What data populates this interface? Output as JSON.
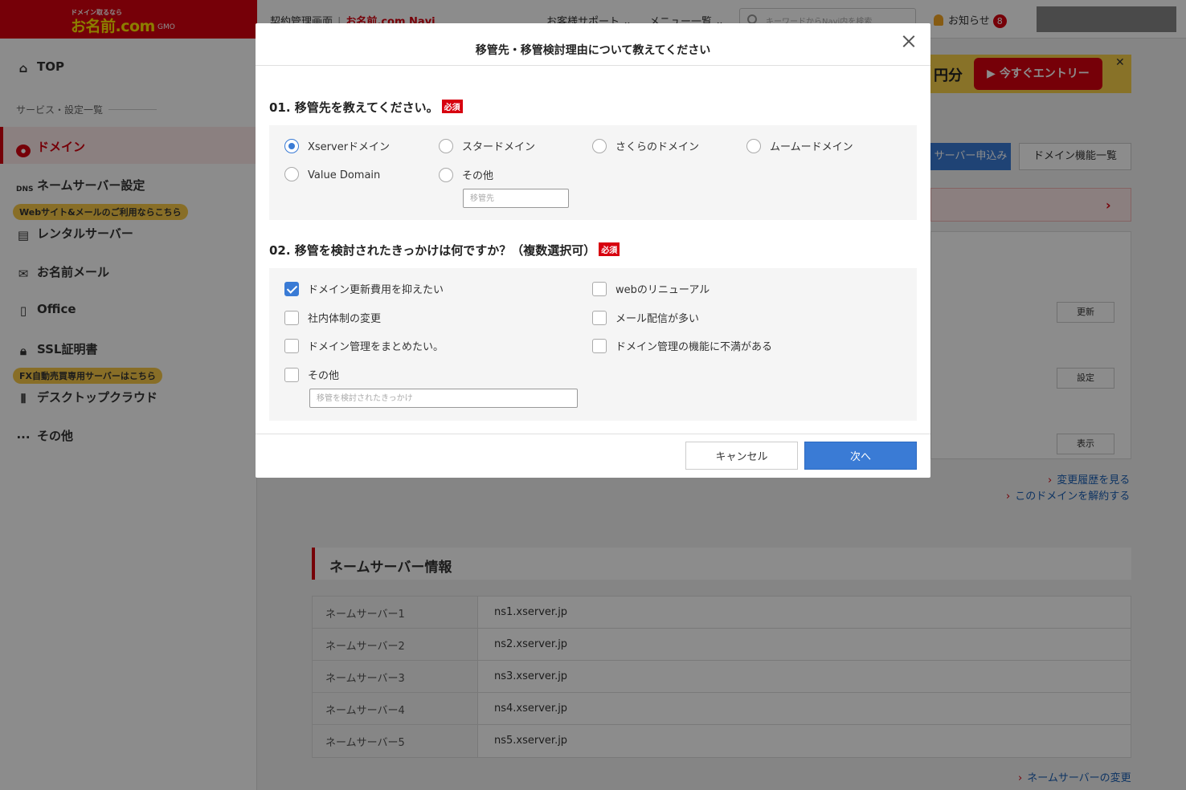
{
  "header": {
    "logo_tagline": "ドメイン取るなら",
    "logo_main": "お名前.com",
    "logo_gmo": "GMO",
    "breadcrumb_1": "契約管理画面",
    "breadcrumb_2": "お名前.com Navi",
    "nav_support": "お客様サポート",
    "nav_menu": "メニュー一覧",
    "search_placeholder": "キーワードからNavi内を検索",
    "notice_label": "お知らせ",
    "notice_count": "8"
  },
  "sidebar": {
    "top": "TOP",
    "section_label": "サービス・設定一覧",
    "domain": "ドメイン",
    "nameserver": "ネームサーバー設定",
    "badge_web": "Webサイト&メールのご利用ならこちら",
    "rental_server": "レンタルサーバー",
    "mail": "お名前メール",
    "office": "Office",
    "ssl": "SSL証明書",
    "badge_fx": "FX自動売買専用サーバーはこちら",
    "desktop_cloud": "デスクトップクラウド",
    "others": "その他"
  },
  "background": {
    "banner_amount": "円分",
    "banner_button": "今すぐエントリー",
    "server_apply": "サーバー申込み",
    "domain_features": "ドメイン機能一覧",
    "btn_renew": "更新",
    "btn_settings": "設定",
    "btn_show": "表示",
    "link_history": "変更履歴を見る",
    "link_cancel": "このドメインを解約する",
    "ns_title": "ネームサーバー情報",
    "ns_rows": [
      {
        "key": "ネームサーバー1",
        "value": "ns1.xserver.jp"
      },
      {
        "key": "ネームサーバー2",
        "value": "ns2.xserver.jp"
      },
      {
        "key": "ネームサーバー3",
        "value": "ns3.xserver.jp"
      },
      {
        "key": "ネームサーバー4",
        "value": "ns4.xserver.jp"
      },
      {
        "key": "ネームサーバー5",
        "value": "ns5.xserver.jp"
      }
    ],
    "link_ns_change": "ネームサーバーの変更"
  },
  "modal": {
    "title": "移管先・移管検討理由について教えてください",
    "q1_title": "01. 移管先を教えてください。",
    "q2_title": "02. 移管を検討されたきっかけは何ですか？（複数選択可）",
    "required": "必須",
    "q1_options": [
      "Xserverドメイン",
      "スタードメイン",
      "さくらのドメイン",
      "ムームードメイン",
      "Value Domain",
      "その他"
    ],
    "q1_selected": "Xserverドメイン",
    "q1_other_placeholder": "移管先",
    "q2_options": [
      "ドメイン更新費用を抑えたい",
      "webのリニューアル",
      "社内体制の変更",
      "メール配信が多い",
      "ドメイン管理をまとめたい。",
      "ドメイン管理の機能に不満がある",
      "その他"
    ],
    "q2_checked": [
      "ドメイン更新費用を抑えたい"
    ],
    "q2_other_placeholder": "移管を検討されたきっかけ",
    "cancel": "キャンセル",
    "next": "次へ"
  },
  "colors": {
    "brand_red": "#d7000f",
    "accent_blue": "#3a7bd5"
  }
}
